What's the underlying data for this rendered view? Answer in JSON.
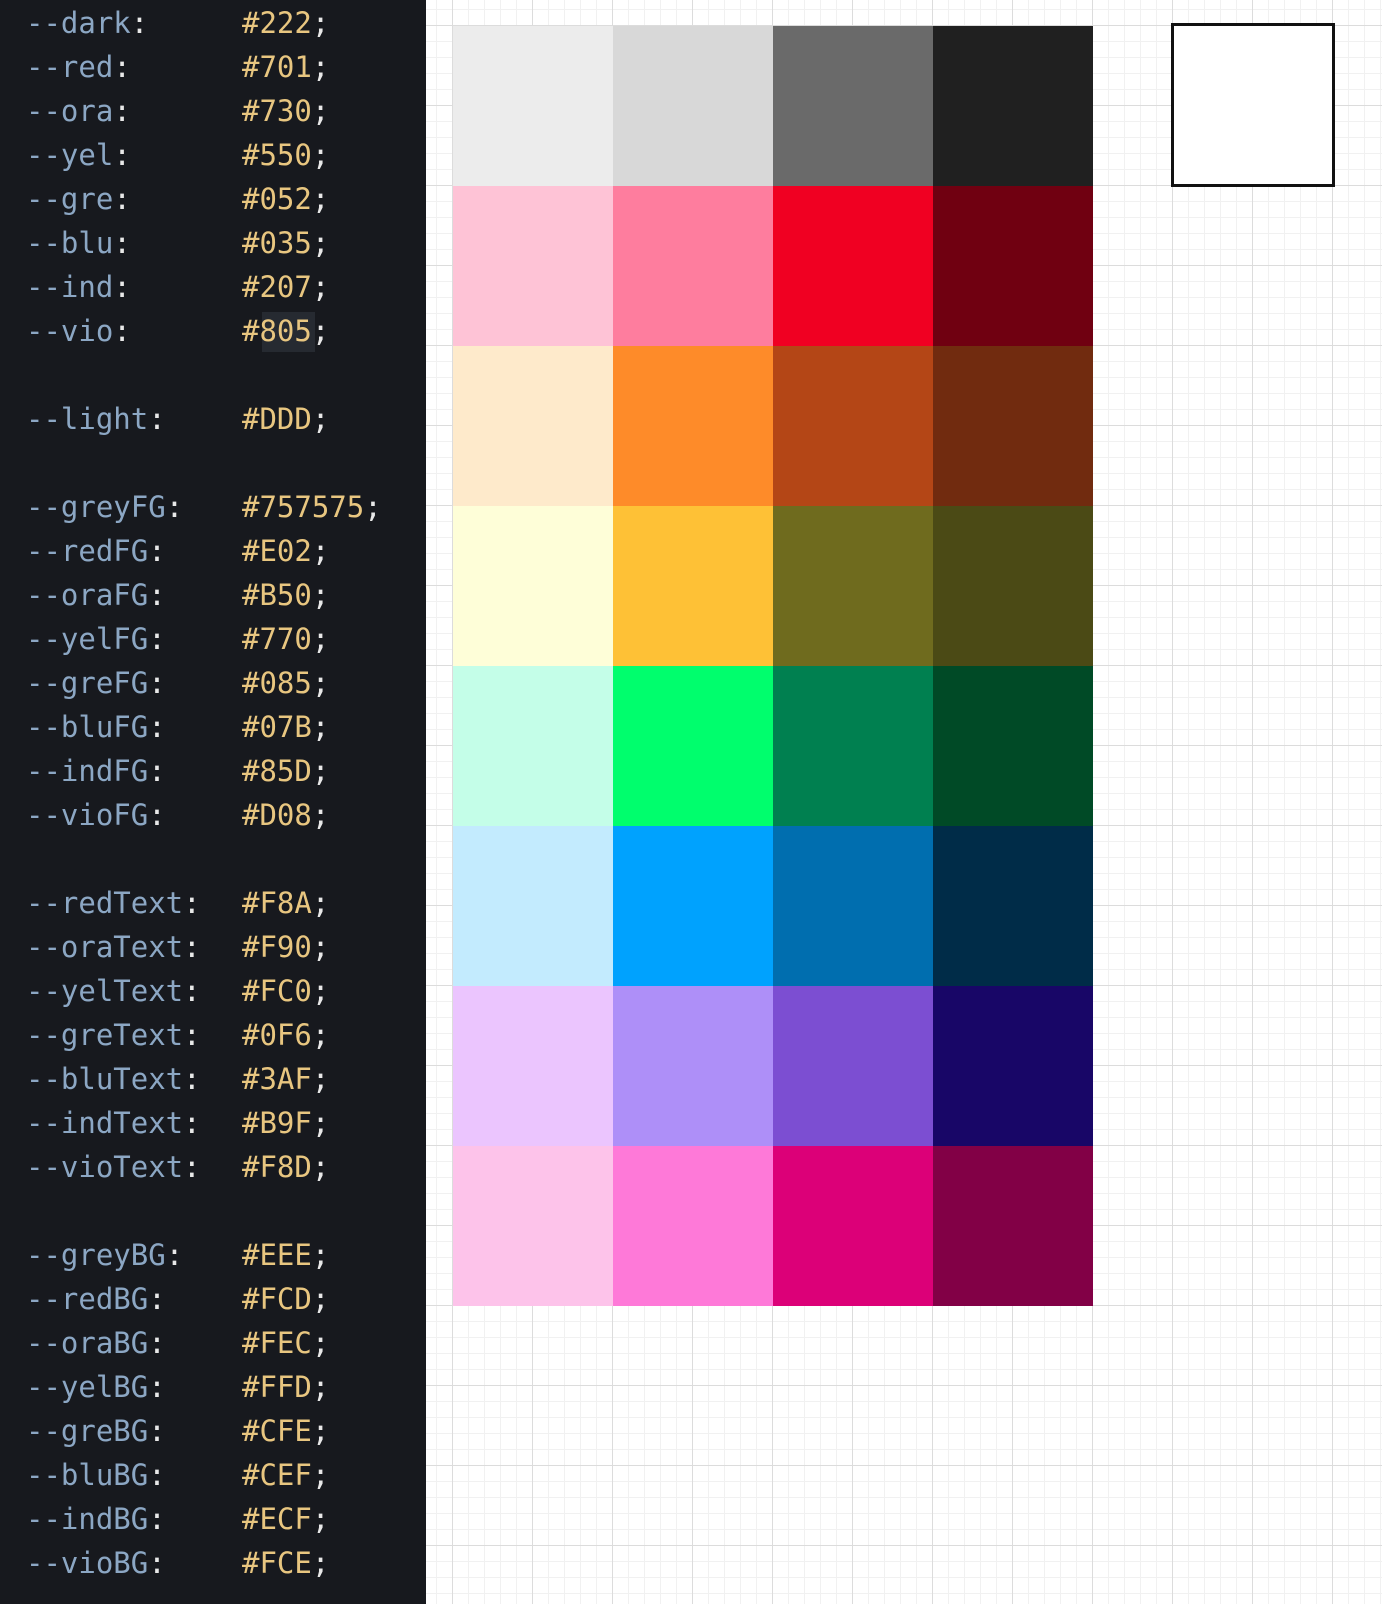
{
  "editor": {
    "lines": [
      {
        "prop": "--dark",
        "value": "#222"
      },
      {
        "prop": "--red",
        "value": "#701"
      },
      {
        "prop": "--ora",
        "value": "#730"
      },
      {
        "prop": "--yel",
        "value": "#550"
      },
      {
        "prop": "--gre",
        "value": "#052"
      },
      {
        "prop": "--blu",
        "value": "#035"
      },
      {
        "prop": "--ind",
        "value": "#207"
      },
      {
        "prop": "--vio",
        "value": "#805"
      },
      null,
      {
        "prop": "--light",
        "value": "#DDD"
      },
      null,
      {
        "prop": "--greyFG",
        "value": "#757575"
      },
      {
        "prop": "--redFG",
        "value": "#E02"
      },
      {
        "prop": "--oraFG",
        "value": "#B50"
      },
      {
        "prop": "--yelFG",
        "value": "#770"
      },
      {
        "prop": "--greFG",
        "value": "#085"
      },
      {
        "prop": "--bluFG",
        "value": "#07B"
      },
      {
        "prop": "--indFG",
        "value": "#85D"
      },
      {
        "prop": "--vioFG",
        "value": "#D08"
      },
      null,
      {
        "prop": "--redText",
        "value": "#F8A"
      },
      {
        "prop": "--oraText",
        "value": "#F90"
      },
      {
        "prop": "--yelText",
        "value": "#FC0"
      },
      {
        "prop": "--greText",
        "value": "#0F6"
      },
      {
        "prop": "--bluText",
        "value": "#3AF"
      },
      {
        "prop": "--indText",
        "value": "#B9F"
      },
      {
        "prop": "--vioText",
        "value": "#F8D"
      },
      null,
      {
        "prop": "--greyBG",
        "value": "#EEE"
      },
      {
        "prop": "--redBG",
        "value": "#FCD"
      },
      {
        "prop": "--oraBG",
        "value": "#FEC"
      },
      {
        "prop": "--yelBG",
        "value": "#FFD"
      },
      {
        "prop": "--greBG",
        "value": "#CFE"
      },
      {
        "prop": "--bluBG",
        "value": "#CEF"
      },
      {
        "prop": "--indBG",
        "value": "#ECF"
      },
      {
        "prop": "--vioBG",
        "value": "#FCE"
      }
    ]
  },
  "swatches": {
    "rows": [
      [
        "#ececec",
        "#d8d8d8",
        "#6a6a6a",
        "#202020"
      ],
      [
        "#fec3d6",
        "#fe7d9e",
        "#f00022",
        "#700011"
      ],
      [
        "#feeacb",
        "#fe8b29",
        "#b44616",
        "#712b0f"
      ],
      [
        "#fefed8",
        "#fec136",
        "#6f6b1e",
        "#4b4a15"
      ],
      [
        "#c4fee8",
        "#00fe6d",
        "#008050",
        "#004a26"
      ],
      [
        "#c3ebfe",
        "#00a2fe",
        "#006eaf",
        "#002c48"
      ],
      [
        "#ebc5fe",
        "#ae8ff8",
        "#7c4ed2",
        "#180667"
      ],
      [
        "#fdc3ea",
        "#fe79d8",
        "#dc0078",
        "#820046"
      ]
    ]
  },
  "selected_swatch": {
    "color": "#ffffff",
    "border_color": "#111111"
  },
  "colors": {
    "editor_bg": "#17191e",
    "prop_color": "#8ca7c4",
    "value_color": "#e8c680",
    "punct_color": "#e8e8e8"
  }
}
